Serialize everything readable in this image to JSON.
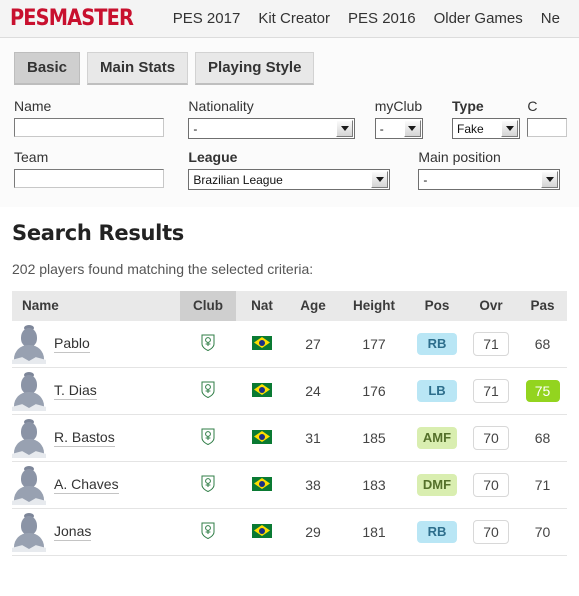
{
  "nav": {
    "brand": "PESMASTER",
    "links": [
      "PES 2017",
      "Kit Creator",
      "PES 2016",
      "Older Games",
      "Ne"
    ]
  },
  "tabs": [
    {
      "label": "Basic",
      "active": true
    },
    {
      "label": "Main Stats",
      "active": false
    },
    {
      "label": "Playing Style",
      "active": false
    }
  ],
  "form": {
    "name": {
      "label": "Name",
      "value": "",
      "placeholder": ""
    },
    "nationality": {
      "label": "Nationality",
      "value": "-"
    },
    "myclub": {
      "label": "myClub",
      "value": "-"
    },
    "type": {
      "label": "Type",
      "value": "Fake"
    },
    "cut_off": {
      "label": "C",
      "value": ""
    },
    "team": {
      "label": "Team",
      "value": "",
      "placeholder": ""
    },
    "league": {
      "label": "League",
      "value": "Brazilian League"
    },
    "main_position": {
      "label": "Main position",
      "value": "-"
    }
  },
  "results": {
    "title": "Search Results",
    "count_text": "202 players found matching the selected criteria:",
    "columns": [
      "Name",
      "Club",
      "Nat",
      "Age",
      "Height",
      "Pos",
      "Ovr",
      "Pas"
    ],
    "sorted_column": "Club",
    "rows": [
      {
        "name": "Pablo",
        "club": "club-crest-icon",
        "nat": "brazil-flag-icon",
        "age": "27",
        "height": "177",
        "pos": "RB",
        "pos_style": "blue",
        "ovr": "71",
        "pas": "68",
        "pas_highlight": false
      },
      {
        "name": "T. Dias",
        "club": "club-crest-icon",
        "nat": "brazil-flag-icon",
        "age": "24",
        "height": "176",
        "pos": "LB",
        "pos_style": "blue",
        "ovr": "71",
        "pas": "75",
        "pas_highlight": true
      },
      {
        "name": "R. Bastos",
        "club": "club-crest-icon",
        "nat": "brazil-flag-icon",
        "age": "31",
        "height": "185",
        "pos": "AMF",
        "pos_style": "green",
        "ovr": "70",
        "pas": "68",
        "pas_highlight": false
      },
      {
        "name": "A. Chaves",
        "club": "club-crest-icon",
        "nat": "brazil-flag-icon",
        "age": "38",
        "height": "183",
        "pos": "DMF",
        "pos_style": "green",
        "ovr": "70",
        "pas": "71",
        "pas_highlight": false
      },
      {
        "name": "Jonas",
        "club": "club-crest-icon",
        "nat": "brazil-flag-icon",
        "age": "29",
        "height": "181",
        "pos": "RB",
        "pos_style": "blue",
        "ovr": "70",
        "pas": "70",
        "pas_highlight": false
      }
    ]
  },
  "colors": {
    "brand_red": "#c8102e",
    "header_bg": "#e9e9e9",
    "sorted_header_bg": "#cfcfcf",
    "pos_blue_bg": "#b9e6f5",
    "pos_green_bg": "#d9eeb0",
    "pas_highlight_bg": "#93d41f"
  }
}
